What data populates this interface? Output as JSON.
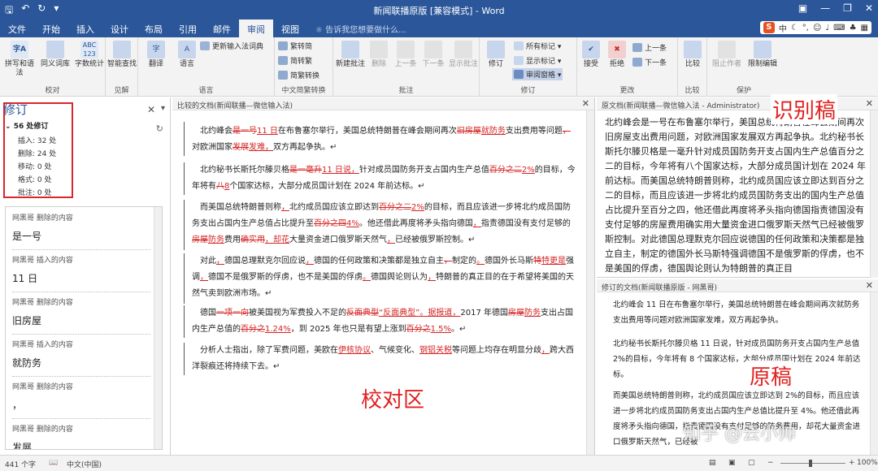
{
  "window": {
    "title": "新闻联播原版 [兼容模式] - Word"
  },
  "tabs": [
    "文件",
    "开始",
    "插入",
    "设计",
    "布局",
    "引用",
    "邮件",
    "审阅",
    "视图"
  ],
  "tellme": "告诉我您想要做什么...",
  "ime": {
    "logo": "S",
    "label": "中"
  },
  "ribbon": {
    "proof": {
      "items": [
        "拼写和语法",
        "同义词库",
        "字数统计"
      ],
      "label": "校对"
    },
    "insights": {
      "items": [
        "智能查找"
      ],
      "label": "见解"
    },
    "language": {
      "items": [
        "翻译",
        "语言"
      ],
      "update_ime": "更新输入法词典",
      "label": "语言"
    },
    "chinese": {
      "items": [
        "繁转简",
        "简转繁",
        "简繁转换"
      ],
      "label": "中文简繁转换"
    },
    "comments": {
      "items": [
        "新建批注",
        "删除",
        "上一条",
        "下一条",
        "显示批注"
      ],
      "label": "批注"
    },
    "tracking": {
      "items": [
        "修订",
        "所有标记",
        "显示标记",
        "审阅窗格"
      ],
      "label": "修订"
    },
    "changes": {
      "items": [
        "接受",
        "拒绝",
        "上一条",
        "下一条"
      ],
      "label": "更改"
    },
    "compare": {
      "items": [
        "比较"
      ],
      "label": "比较"
    },
    "protect": {
      "items": [
        "阻止作者",
        "限制编辑"
      ],
      "label": "保护"
    }
  },
  "review_pane": {
    "title": "修订",
    "total": "56 处修订",
    "stats": [
      "插入: 32 处",
      "删除: 24 处",
      "移动: 0 处",
      "格式: 0 处",
      "批注: 0 处"
    ],
    "items": [
      {
        "header": "网黑哥 删除的内容",
        "content": "是一号"
      },
      {
        "header": "网黑哥 插入的内容",
        "content": "11 日"
      },
      {
        "header": "网黑哥 删除的内容",
        "content": "旧房屋"
      },
      {
        "header": "网黑哥 插入的内容",
        "content": "就防务"
      },
      {
        "header": "网黑哥 删除的内容",
        "content": "，"
      },
      {
        "header": "网黑哥 删除的内容",
        "content": "发展"
      }
    ]
  },
  "compare_doc": {
    "header": "比较的文档(新闻联播—微信输入法)",
    "overlay_label": "校对区"
  },
  "original_doc": {
    "header": "原文档(新闻联播—微信输入法 - Administrator)",
    "overlay_label": "识别稿",
    "text": "北约峰会是一号在布鲁塞尔举行，美国总统特朗普在峰会期间再次旧房屋支出费用问题，对欧洲国家发展双方再起争执。北约秘书长斯托尔滕贝格是一毫升针对成员国防务开支占国内生产总值百分之二的目标，今年将有八个国家达标，大部分成员国计划在 2024 年前达标。而美国总统特朗普则称，北约成员国应该立即达到百分之二的目标，而且应该进一步将北约成员国防务支出的国内生产总值占比提升至百分之四，他还借此再度将矛头指向德国指责德国没有支付足够的房屋费用确实用大量资金进口俄罗斯天然气已经被俄罗斯控制。对此德国总理默克尔回应说德国的任何政策和决策都是独立自主，制定的德国外长马斯特强调德国不是俄罗斯的俘虏，也不是美国的俘虏，德国舆论则认为特朗普的真正目"
  },
  "revised_doc": {
    "header": "修订的文档(新闻联播原版 - 网黑哥)",
    "overlay_label": "原稿",
    "paragraphs": [
      "北约峰会 11 日在布鲁塞尔举行，美国总统特朗普在峰会期间再次就防务支出费用等问题对欧洲国家发难，双方再起争执。",
      "北约秘书长斯托尔滕贝格 11 日说，针对成员国防务开支占国内生产总值 2%的目标，今年将有 8 个国家达标，大部分成员国计划在 2024 年前达标。",
      "而美国总统特朗普则称，北约成员国应该立即达到 2%的目标，而且应该进一步将北约成员国防务支出占国内生产总值比提升至 4%。他还借此再度将矛头指向德国，指责德国没有支付足够的防务费用，却花大量资金进口俄罗斯天然气，已经被"
    ]
  },
  "watermark": "知乎 @云小帅",
  "status": {
    "words": "441 个字",
    "lang": "中文(中国)",
    "zoom": "100%"
  }
}
